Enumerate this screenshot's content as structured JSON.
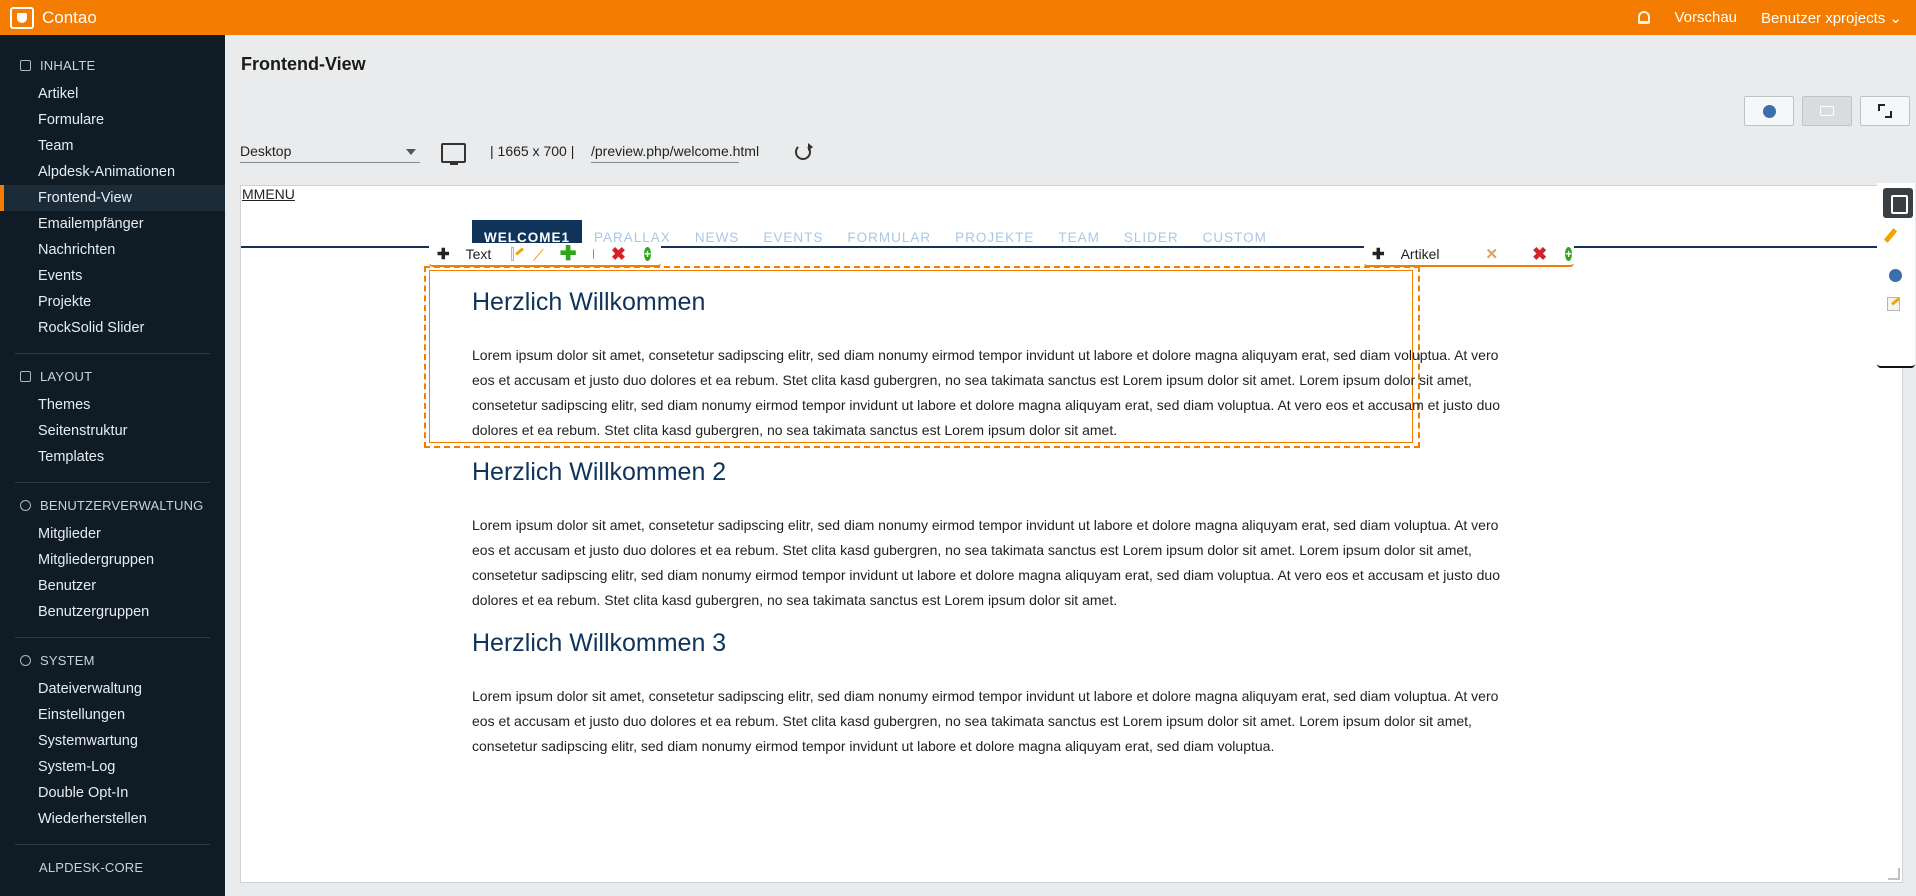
{
  "topbar": {
    "brand": "Contao",
    "preview_label": "Vorschau",
    "user_label": "Benutzer xprojects",
    "user_caret": "⌄"
  },
  "sidebar": {
    "groups": [
      {
        "title": "INHALTE",
        "items": [
          "Artikel",
          "Formulare",
          "Team",
          "Alpdesk-Animationen",
          "Frontend-View",
          "Emailempfänger",
          "Nachrichten",
          "Events",
          "Projekte",
          "RockSolid Slider"
        ]
      },
      {
        "title": "LAYOUT",
        "items": [
          "Themes",
          "Seitenstruktur",
          "Templates"
        ]
      },
      {
        "title": "BENUTZERVERWALTUNG",
        "items": [
          "Mitglieder",
          "Mitgliedergruppen",
          "Benutzer",
          "Benutzergruppen"
        ]
      },
      {
        "title": "SYSTEM",
        "items": [
          "Dateiverwaltung",
          "Einstellungen",
          "Systemwartung",
          "System-Log",
          "Double Opt-In",
          "Wiederherstellen"
        ]
      },
      {
        "title": "ALPDESK-CORE",
        "items": []
      }
    ],
    "active_item": "Frontend-View"
  },
  "main": {
    "title": "Frontend-View",
    "device": "Desktop",
    "resolution": "| 1665 x 700 |",
    "url": "/preview.php/welcome.html"
  },
  "preview": {
    "mmenu": "MMENU",
    "nav": [
      "WELCOME1",
      "PARALLAX",
      "NEWS",
      "EVENTS",
      "FORMULAR",
      "PROJEKTE",
      "TEAM",
      "SLIDER",
      "CUSTOM"
    ],
    "text_toolbar_label": "Text",
    "article_toolbar_label": "Artikel",
    "articles": [
      {
        "heading": "Herzlich Willkommen",
        "paragraph": "Lorem ipsum dolor sit amet, consetetur sadipscing elitr, sed diam nonumy eirmod tempor invidunt ut labore et dolore magna aliquyam erat, sed diam voluptua. At vero eos et accusam et justo duo dolores et ea rebum. Stet clita kasd gubergren, no sea takimata sanctus est Lorem ipsum dolor sit amet. Lorem ipsum dolor sit amet, consetetur sadipscing elitr, sed diam nonumy eirmod tempor invidunt ut labore et dolore magna aliquyam erat, sed diam voluptua. At vero eos et accusam et justo duo dolores et ea rebum. Stet clita kasd gubergren, no sea takimata sanctus est Lorem ipsum dolor sit amet."
      },
      {
        "heading": "Herzlich Willkommen 2",
        "paragraph": "Lorem ipsum dolor sit amet, consetetur sadipscing elitr, sed diam nonumy eirmod tempor invidunt ut labore et dolore magna aliquyam erat, sed diam voluptua. At vero eos et accusam et justo duo dolores et ea rebum. Stet clita kasd gubergren, no sea takimata sanctus est Lorem ipsum dolor sit amet. Lorem ipsum dolor sit amet, consetetur sadipscing elitr, sed diam nonumy eirmod tempor invidunt ut labore et dolore magna aliquyam erat, sed diam voluptua. At vero eos et accusam et justo duo dolores et ea rebum. Stet clita kasd gubergren, no sea takimata sanctus est Lorem ipsum dolor sit amet."
      },
      {
        "heading": "Herzlich Willkommen 3",
        "paragraph": "Lorem ipsum dolor sit amet, consetetur sadipscing elitr, sed diam nonumy eirmod tempor invidunt ut labore et dolore magna aliquyam erat, sed diam voluptua. At vero eos et accusam et justo duo dolores et ea rebum. Stet clita kasd gubergren, no sea takimata sanctus est Lorem ipsum dolor sit amet. Lorem ipsum dolor sit amet, consetetur sadipscing elitr, sed diam nonumy eirmod tempor invidunt ut labore et dolore magna aliquyam erat, sed diam voluptua."
      }
    ]
  },
  "icons": {
    "move": "✚",
    "plus": "✚",
    "close": "✖",
    "add_circle": "+"
  },
  "colors": {
    "accent": "#f47c00",
    "sidebar_bg": "#0f1c26",
    "heading_blue": "#0f3359",
    "nav_inactive": "#a9c7e6"
  }
}
